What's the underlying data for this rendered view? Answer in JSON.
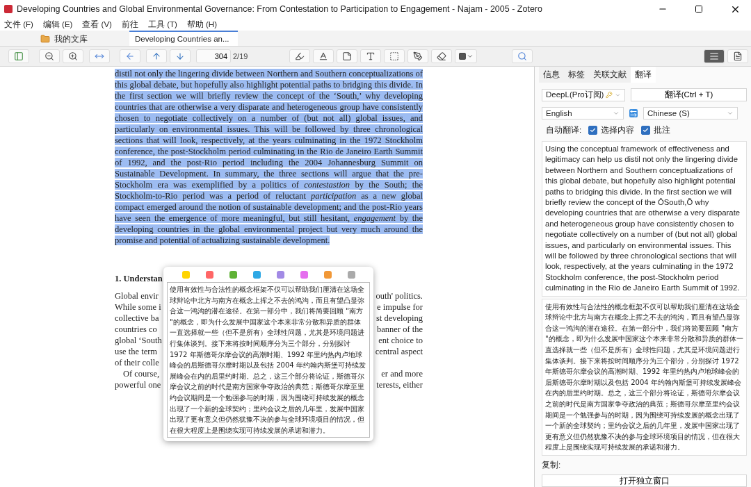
{
  "window": {
    "title": "Developing Countries and Global Environmental Governance: From Contestation to Participation to Engagement - Najam - 2005 - Zotero"
  },
  "menu": [
    "文件 (F)",
    "编辑 (E)",
    "查看 (V)",
    "前往",
    "工具 (T)",
    "帮助 (H)"
  ],
  "tabs": [
    {
      "label": "我的文库",
      "kind": "library",
      "selected": false
    },
    {
      "label": "Developing Countries an...",
      "kind": "document",
      "selected": true
    }
  ],
  "toolbar": {
    "page": "304",
    "page_count": "2/19",
    "view_modes": [
      {
        "selected": true
      },
      {
        "selected": false
      }
    ]
  },
  "document": {
    "selected_text": "distil not only the lingering divide between Northern and Southern conceptualizations of this global debate, but hopefully also highlight potential paths to bridging this divide. In the first section we will briefly review the concept of the ‘South,’ why developing countries that are otherwise a very disparate and heterogeneous group have consistently chosen to negotiate collectively on a number of (but not all) global issues, and particularly on environmental issues. This will be followed by three chronological sections that will look, respectively, at the years culminating in the 1972 Stockholm conference, the post-Stockholm period culminating in the Rio de Janeiro Earth Summit of 1992, and the post-Rio period including the 2004 Johannesburg Summit on Sustainable Development. In summary, the three sections will argue that the pre-Stockholm era was exemplified by a politics of *contestastion* by the South; the Stockholm-to-Rio period was a period of reluctant *participation* as a new global compact emerged around the notion of sustainable development; and the post-Rio years have seen the emergence of more meaningful, but still hesitant, *engagement* by the developing countries in the global environmental project but very much around the promise and potential of actualizing sustainable development.",
    "heading": "1. Understan",
    "lines": [
      {
        "kind": "line",
        "left": "Global envir",
        "right": "outh' politics."
      },
      {
        "kind": "line",
        "left": "While some i",
        "right": "e impulse for"
      },
      {
        "kind": "line",
        "left": "collective ba",
        "right": "st developing"
      },
      {
        "kind": "line",
        "left": "countries co",
        "right": "banner of the"
      },
      {
        "kind": "line",
        "left": "global ‘South",
        "right": "ent choice to"
      },
      {
        "kind": "line",
        "left": "use the term",
        "right": "central aspect"
      },
      {
        "kind": "line",
        "left": "of their colle"
      },
      {
        "kind": "indent",
        "left": "Of course,",
        "right": "er and more"
      },
      {
        "kind": "line",
        "left": "powerful one",
        "right": "terests, either"
      }
    ]
  },
  "popup": {
    "colors": [
      {
        "color": "#ffd400"
      },
      {
        "color": "#ff6666"
      },
      {
        "color": "#5fb236"
      },
      {
        "color": "#2ea8e5"
      },
      {
        "color": "#a28ae5"
      },
      {
        "color": "#e56eee"
      },
      {
        "color": "#f19837"
      },
      {
        "color": "#aaaaaa"
      }
    ],
    "translation": "使用有效性与合法性的概念框架不仅可以帮助我们厘清在这场全球辩论中北方与南方在概念上挥之不去的鸿沟，而且有望凸显弥合这一鸿沟的潜在途径。在第一部分中，我们将简要回顾 \"南方 \"的概念，即为什么发展中国家这个本来非常分散和异质的群体一直选择就一些（但不是所有）全球性问题，尤其是环境问题进行集体谈判。接下来将按时间顺序分为三个部分，分别探讨 1972 年斯德哥尔摩会议的高潮时期、1992 年里约热内卢地球峰会的后斯德哥尔摩时期以及包括 2004 年约翰内斯堡可持续发展峰会在内的后里约时期。总之，这三个部分将论证，斯德哥尔摩会议之前的时代是南方国家争夺政治的典范；斯德哥尔摩至里约会议期间是一个勉强参与的时期，因为围绕可持续发展的概念出现了一个新的全球契约；里约会议之后的几年里，发展中国家出现了更有意义但仍然犹豫不决的参与全球环境项目的情况，但在很大程度上是围绕实现可持续发展的承诺和潜力。"
  },
  "side_panel": {
    "tabs": [
      {
        "label": "信息",
        "selected": false
      },
      {
        "label": "标签",
        "selected": false
      },
      {
        "label": "关联文献",
        "selected": false
      },
      {
        "label": "翻译",
        "selected": true
      }
    ],
    "engine": "DeepL(Pro订阅)",
    "translate_button": "翻译(Ctrl + T)",
    "source_language": "English",
    "target_language": "Chinese (S)",
    "auto_translate_label": "自动翻译:",
    "auto_translate_options": [
      {
        "label": "选择内容",
        "checked": true
      },
      {
        "label": "批注",
        "checked": true
      }
    ],
    "source_text": "Using the conceptual framework of effectiveness and legitimacy can help us distil not only the lingering divide between Northern and Southern conceptualizations of this global debate, but hopefully also highlight potential paths to bridging this divide. In the first section we will briefly review the concept of the ÔSouth,Õ why developing countries that are otherwise a very disparate and heterogeneous group have consistently chosen to negotiate collectively on a number of (but not all) global issues, and particularly on environmental issues. This will be followed by three chronological sections that will look, respectively, at the years culminating in the 1972 Stockholm conference, the post-Stockholm period culminating in the Rio de Janeiro Earth Summit of 1992.",
    "translation": "使用有效性与合法性的概念框架不仅可以帮助我们厘清在这场全球辩论中北方与南方在概念上挥之不去的鸿沟，而且有望凸显弥合这一鸿沟的潜在途径。在第一部分中，我们将简要回顾 \"南方 \"的概念，即为什么发展中国家这个本来非常分散和异质的群体一直选择就一些（但不是所有）全球性问题，尤其是环境问题进行集体谈判。接下来将按时间顺序分为三个部分，分别探讨 1972 年斯德哥尔摩会议的高潮时期、1992 年里约热内卢地球峰会的后斯德哥尔摩时期以及包括 2004 年约翰内斯堡可持续发展峰会在内的后里约时期。总之，这三个部分将论证，斯德哥尔摩会议之前的时代是南方国家争夺政治的典范；斯德哥尔摩至里约会议期间是一个勉强参与的时期，因为围绕可持续发展的概念出现了一个新的全球契约；里约会议之后的几年里，发展中国家出现了更有意义但仍然犹豫不决的参与全球环境项目的情况，但在很大程度上是围绕实现可持续发展的承诺和潜力。",
    "copy_label": "复制:",
    "open_window_button": "打开独立窗口"
  }
}
